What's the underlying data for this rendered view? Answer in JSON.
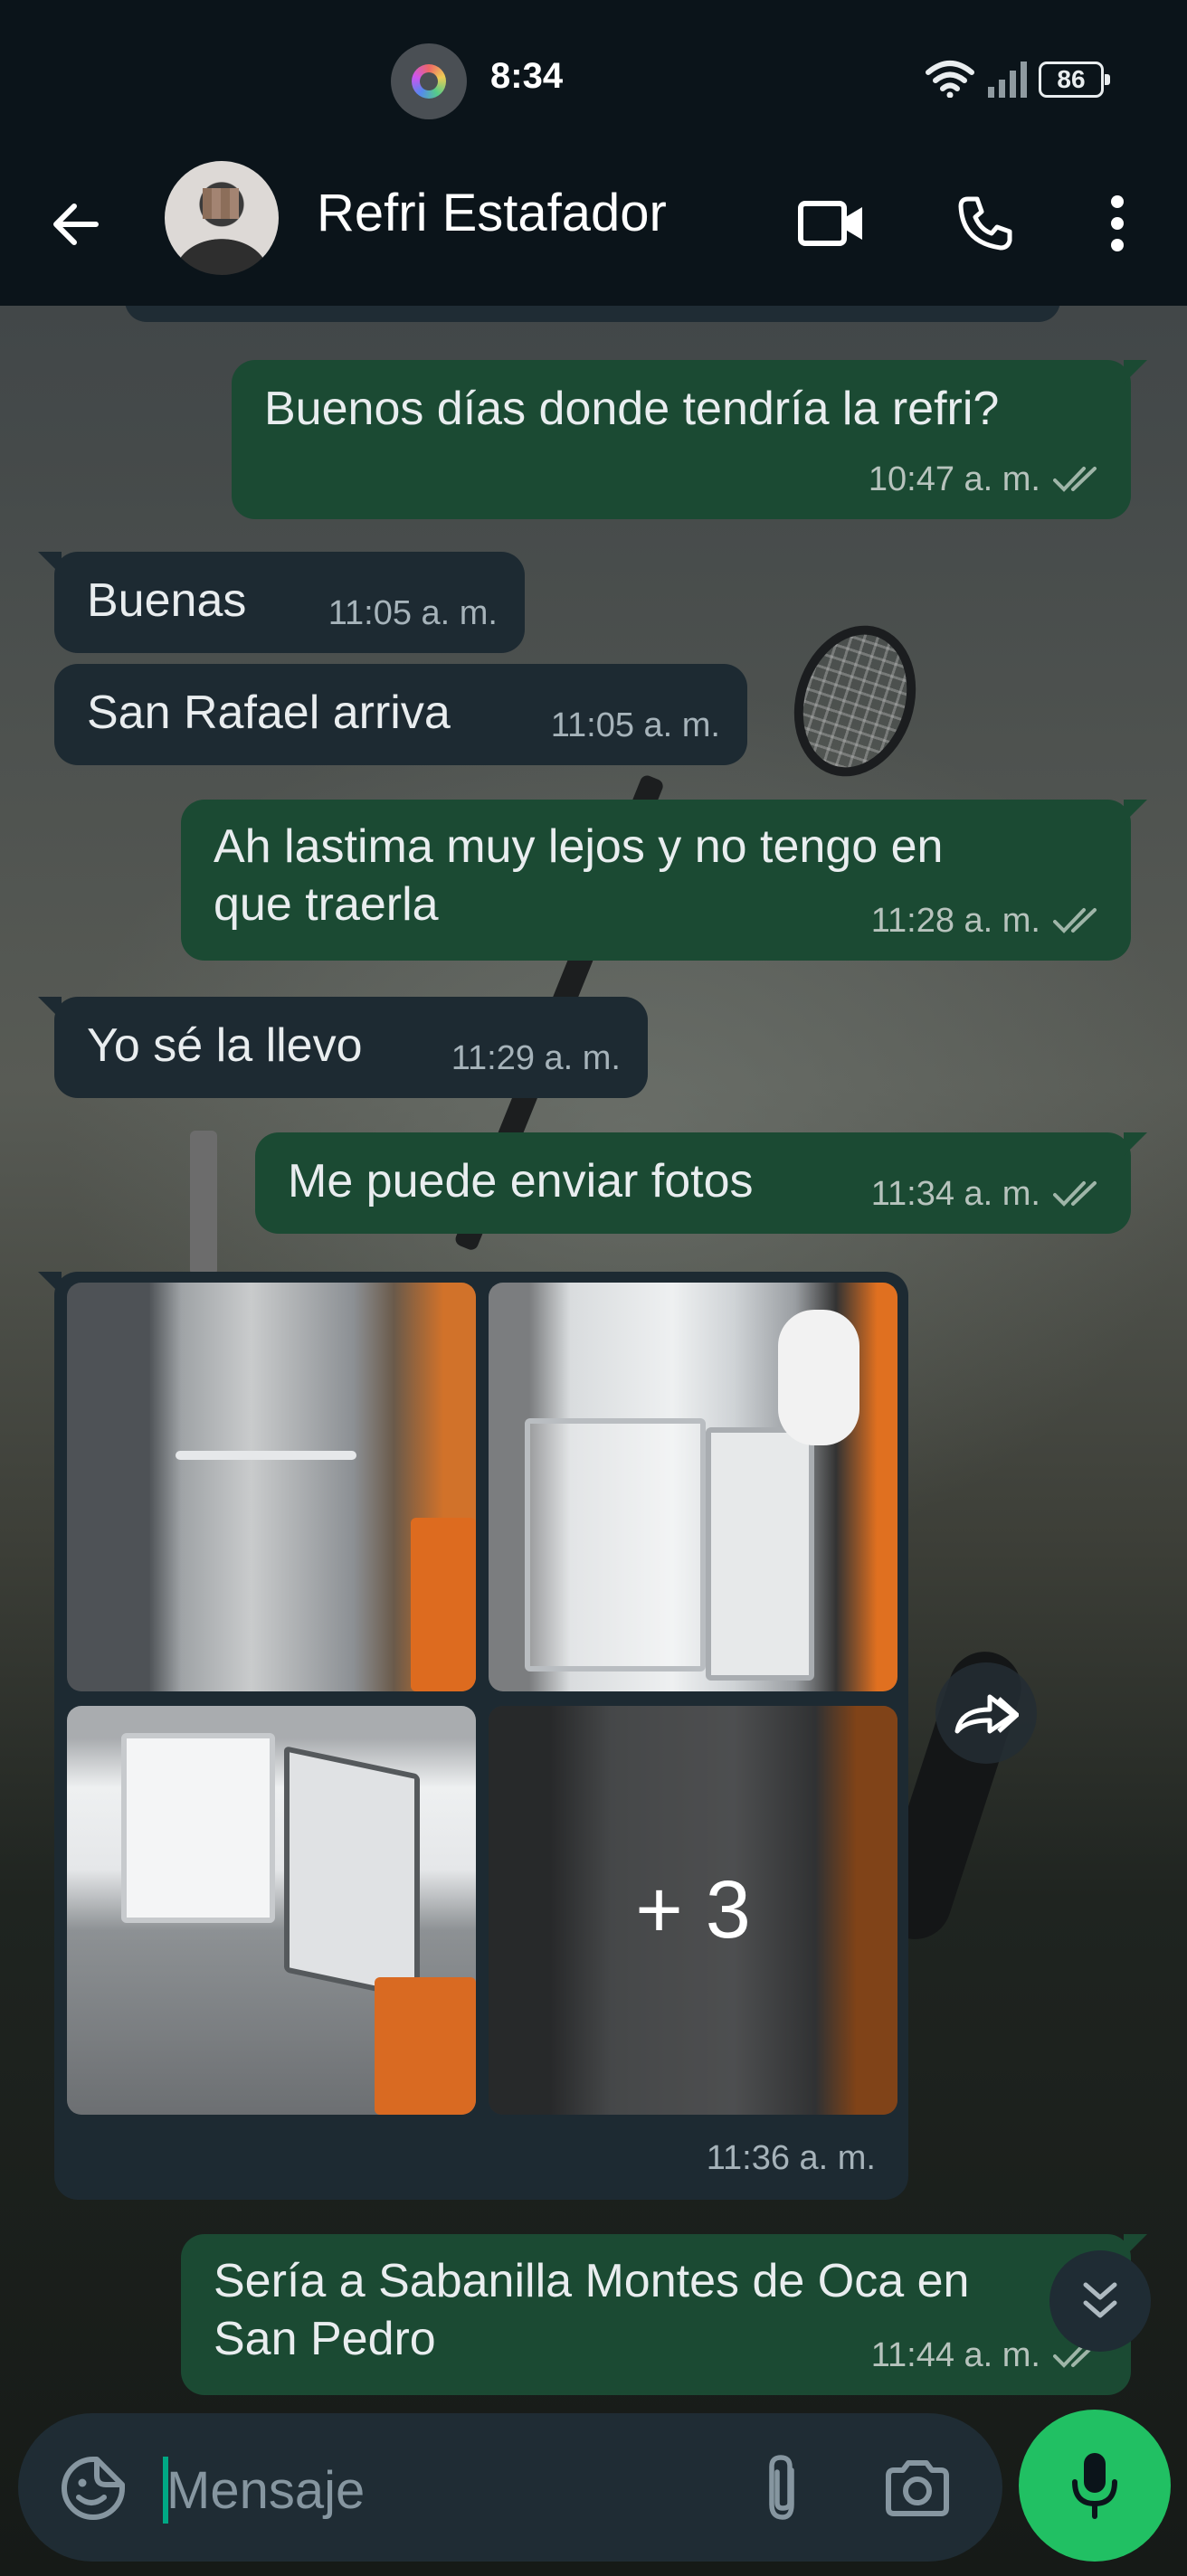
{
  "status_bar": {
    "time": "8:34",
    "battery": "86",
    "icons": [
      "screen-record-icon",
      "wifi-icon",
      "signal-icon",
      "battery-icon"
    ]
  },
  "header": {
    "contact_name": "Refri Estafador",
    "icons": [
      "back-arrow-icon",
      "video-call-icon",
      "phone-icon",
      "more-vert-icon"
    ]
  },
  "messages": [
    {
      "direction": "out",
      "text": "Buenos días donde tendría la refri?",
      "time": "10:47 a. m.",
      "status": "read"
    },
    {
      "direction": "in",
      "text": "Buenas",
      "time": "11:05 a. m."
    },
    {
      "direction": "in",
      "text": "San Rafael arriva",
      "time": "11:05 a. m."
    },
    {
      "direction": "out",
      "text": "Ah lastima muy lejos y no tengo en\nque traerla",
      "time": "11:28 a. m.",
      "status": "read"
    },
    {
      "direction": "in",
      "text": "Yo sé la llevo",
      "time": "11:29 a. m."
    },
    {
      "direction": "out",
      "text": "Me puede enviar fotos",
      "time": "11:34 a. m.",
      "status": "read"
    },
    {
      "direction": "in",
      "type": "media-album",
      "more_count": "+ 3",
      "time": "11:36 a. m."
    },
    {
      "direction": "out",
      "text": "Sería a Sabanilla Montes de Oca en\nSan Pedro",
      "time": "11:44 a. m.",
      "status": "read"
    }
  ],
  "composer": {
    "placeholder": "Mensaje",
    "icons": [
      "sticker-icon",
      "attach-icon",
      "camera-icon",
      "mic-icon"
    ]
  },
  "colors": {
    "outgoing_bubble": "#1b4a33",
    "incoming_bubble": "#1d2a32",
    "accent": "#21c063",
    "app_bar": "#0b141a"
  }
}
